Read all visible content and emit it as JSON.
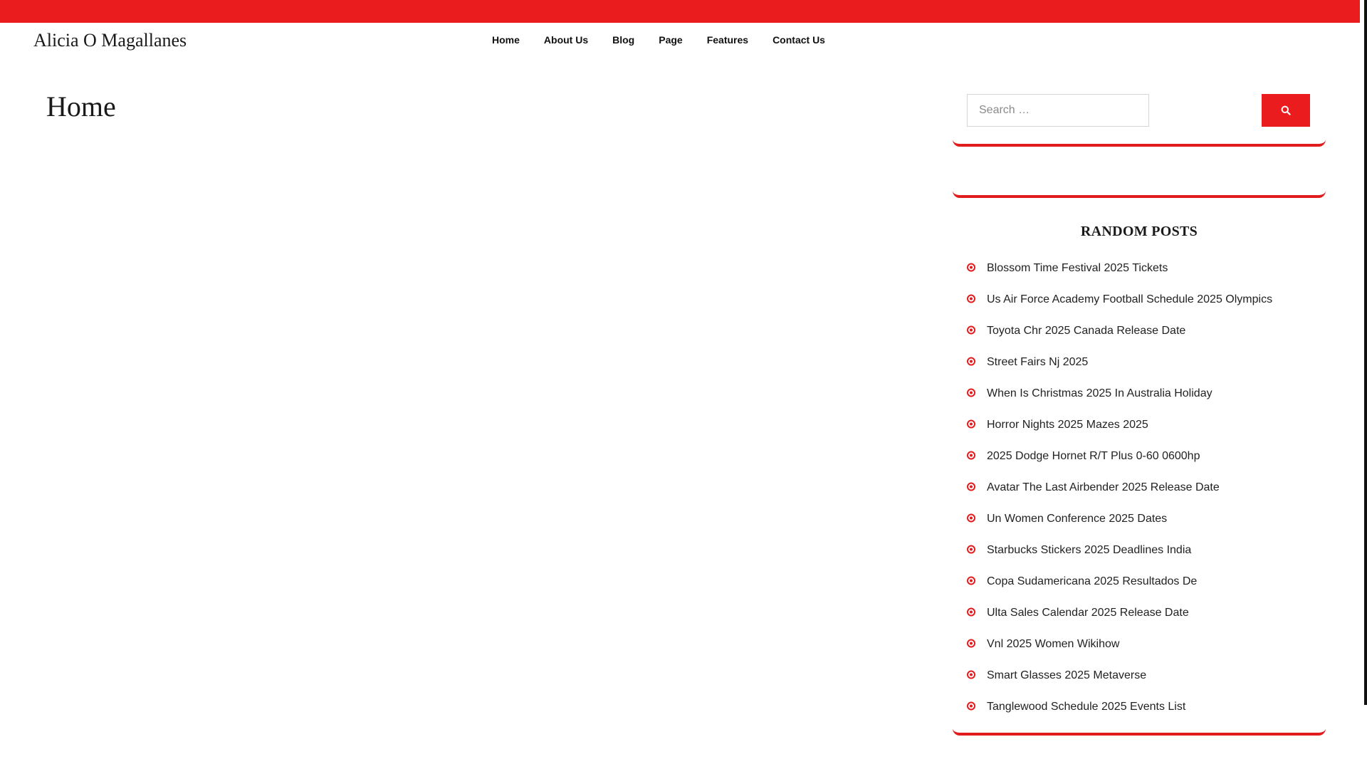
{
  "site": {
    "title": "Alicia O Magallanes"
  },
  "nav": {
    "items": [
      "Home",
      "About Us",
      "Blog",
      "Page",
      "Features",
      "Contact Us"
    ]
  },
  "main": {
    "page_title": "Home"
  },
  "sidebar": {
    "search": {
      "placeholder": "Search …",
      "button_icon": "search-icon"
    },
    "random_posts": {
      "title": "RANDOM POSTS",
      "items": [
        "Blossom Time Festival 2025 Tickets",
        "Us Air Force Academy Football Schedule 2025 Olympics",
        "Toyota Chr 2025 Canada Release Date",
        "Street Fairs Nj 2025",
        "When Is Christmas 2025 In Australia Holiday",
        "Horror Nights 2025 Mazes 2025",
        "2025 Dodge Hornet R/T Plus 0-60 0600hp",
        "Avatar The Last Airbender 2025 Release Date",
        "Un Women Conference 2025 Dates",
        "Starbucks Stickers 2025 Deadlines India",
        "Copa Sudamericana 2025 Resultados De",
        "Ulta Sales Calendar 2025 Release Date",
        "Vnl 2025 Women Wikihow",
        "Smart Glasses 2025 Metaverse",
        "Tanglewood Schedule 2025 Events List"
      ]
    }
  },
  "colors": {
    "accent": "#ea1c1e",
    "text": "#1a1a1a"
  }
}
